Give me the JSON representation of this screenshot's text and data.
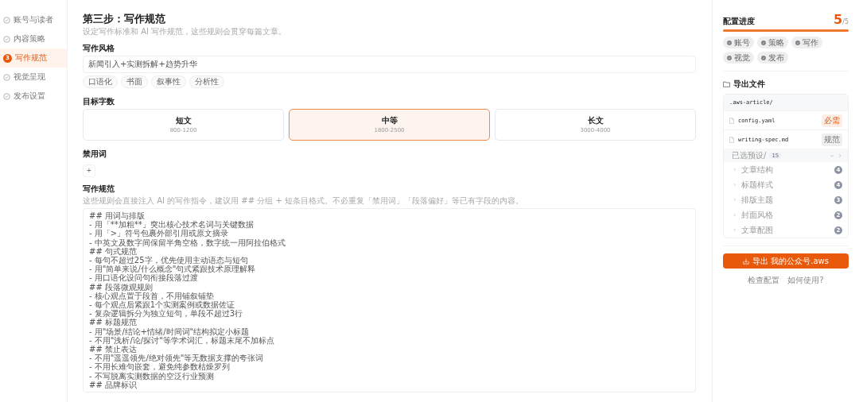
{
  "sidebar": {
    "items": [
      {
        "label": "账号与读者",
        "selected": false
      },
      {
        "label": "内容策略",
        "selected": false
      },
      {
        "label": "写作规范",
        "selected": true,
        "badge": "3"
      },
      {
        "label": "视觉呈现",
        "selected": false
      },
      {
        "label": "发布设置",
        "selected": false
      }
    ]
  },
  "main": {
    "title": "第三步：写作规范",
    "subtitle": "设定写作标准和 AI 写作规范，这些规则会贯穿每篇文章。",
    "style": {
      "label": "写作风格",
      "value": "新闻引入+实测拆解+趋势升华",
      "chips": [
        "口语化",
        "书面",
        "叙事性",
        "分析性"
      ]
    },
    "length": {
      "label": "目标字数",
      "options": [
        {
          "title": "短文",
          "range": "800-1200",
          "selected": false
        },
        {
          "title": "中等",
          "range": "1800-2500",
          "selected": true
        },
        {
          "title": "长文",
          "range": "3000-4000",
          "selected": false
        }
      ]
    },
    "banned": {
      "label": "禁用词",
      "add": "+"
    },
    "rules": {
      "label": "写作规范",
      "hint": "这些规则会直接注入 AI 的写作指令，建议用 ## 分组 + 短条目格式。不必重复「禁用词」「段落偏好」等已有字段的内容。",
      "lines": [
        "## 用词与排版",
        "- 用「**加粗**」突出核心技术名词与关键数据",
        "- 用「>」符号包裹外部引用或原文摘录",
        "- 中英文及数字间保留半角空格，数字统一用阿拉伯格式",
        "## 句式规范",
        "- 每句不超过25字，优先使用主动语态与短句",
        "- 用\"简单来说/什么概念\"句式紧跟技术原理解释",
        "- 用口语化设问句衔接段落过渡",
        "## 段落微观规则",
        "- 核心观点置于段首，不用铺叙铺垫",
        "- 每个观点后紧跟1个实测案例或数据佐证",
        "- 复杂逻辑拆分为独立短句，单段不超过3行",
        "## 标题规范",
        "- 用\"场景/结论+情绪/时间词\"结构拟定小标题",
        "- 不用\"浅析/论/探讨\"等学术词汇，标题末尾不加标点",
        "## 禁止表达",
        "- 不用\"遥遥领先/绝对领先\"等无数据支撑的夸张词",
        "- 不用长难句嵌套，避免纯参数枯燥罗列",
        "- 不写脱离实测数据的空泛行业预测",
        "## 品牌标识"
      ]
    }
  },
  "progress": {
    "title": "配置进度",
    "done": "5",
    "total": "/5",
    "level": 1,
    "steps": [
      {
        "label": "账号",
        "done": true
      },
      {
        "label": "策略",
        "done": true
      },
      {
        "label": "写作",
        "done": true
      },
      {
        "label": "视觉",
        "done": true
      },
      {
        "label": "发布",
        "done": true
      }
    ]
  },
  "export": {
    "title": "导出文件",
    "root": ".aws-article/",
    "files": [
      {
        "name": "config.yaml",
        "tag": "必需",
        "kind": "required"
      },
      {
        "name": "writing-spec.md",
        "tag": "规范",
        "kind": "spec"
      }
    ],
    "folder": {
      "name": "已选预设/",
      "count": "15",
      "expanded": true,
      "children": [
        {
          "name": "文章结构",
          "count": "4",
          "expanded": false
        },
        {
          "name": "标题样式",
          "count": "4",
          "expanded": false
        },
        {
          "name": "排版主题",
          "count": "3",
          "expanded": false
        },
        {
          "name": "封面风格",
          "count": "2",
          "expanded": false
        },
        {
          "name": "文章配图",
          "count": "2",
          "expanded": false
        }
      ]
    },
    "button": "导出 我的公众号.aws",
    "links": [
      "检查配置",
      "如何使用?"
    ]
  }
}
